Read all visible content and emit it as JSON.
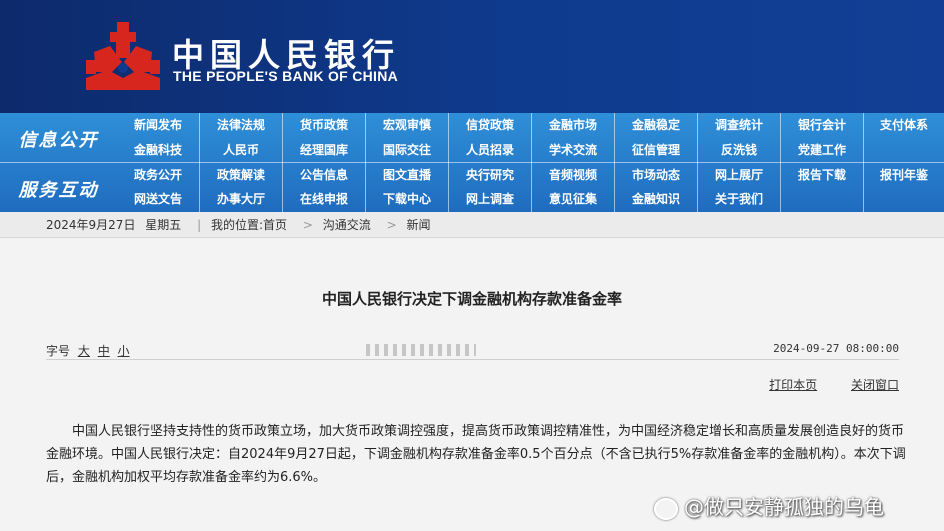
{
  "header": {
    "cn_name": "中国人民银行",
    "en_name": "THE PEOPLE'S BANK OF CHINA",
    "logo_color": "#d7261e"
  },
  "nav": {
    "section1": "信息公开",
    "section2": "服务互动",
    "rows": [
      [
        "新闻发布",
        "法律法规",
        "货币政策",
        "宏观审慎",
        "信贷政策",
        "金融市场",
        "金融稳定",
        "调查统计",
        "银行会计",
        "支付体系"
      ],
      [
        "金融科技",
        "人民币",
        "经理国库",
        "国际交往",
        "人员招录",
        "学术交流",
        "征信管理",
        "反洗钱",
        "党建工作",
        ""
      ],
      [
        "政务公开",
        "政策解读",
        "公告信息",
        "图文直播",
        "央行研究",
        "音频视频",
        "市场动态",
        "网上展厅",
        "报告下载",
        "报刊年鉴"
      ],
      [
        "网送文告",
        "办事大厅",
        "在线申报",
        "下载中心",
        "网上调查",
        "意见征集",
        "金融知识",
        "关于我们",
        "",
        ""
      ]
    ]
  },
  "breadcrumb": {
    "date": "2024年9月27日",
    "weekday": "星期五",
    "location_label": "我的位置:首页",
    "level2": "沟通交流",
    "level3": "新闻",
    "sep": ">"
  },
  "article": {
    "title": "中国人民银行决定下调金融机构存款准备金率",
    "size_label": "字号",
    "size_large": "大",
    "size_medium": "中",
    "size_small": "小",
    "datetime": "2024-09-27 08:00:00",
    "print_label": "打印本页",
    "close_label": "关闭窗口",
    "body": "中国人民银行坚持支持性的货币政策立场，加大货币政策调控强度，提高货币政策调控精准性，为中国经济稳定增长和高质量发展创造良好的货币金融环境。中国人民银行决定：自2024年9月27日起，下调金融机构存款准备金率0.5个百分点（不含已执行5%存款准备金率的金融机构）。本次下调后，金融机构加权平均存款准备金率约为6.6%。"
  },
  "watermark": {
    "text": "@做只安静孤独的乌龟"
  }
}
